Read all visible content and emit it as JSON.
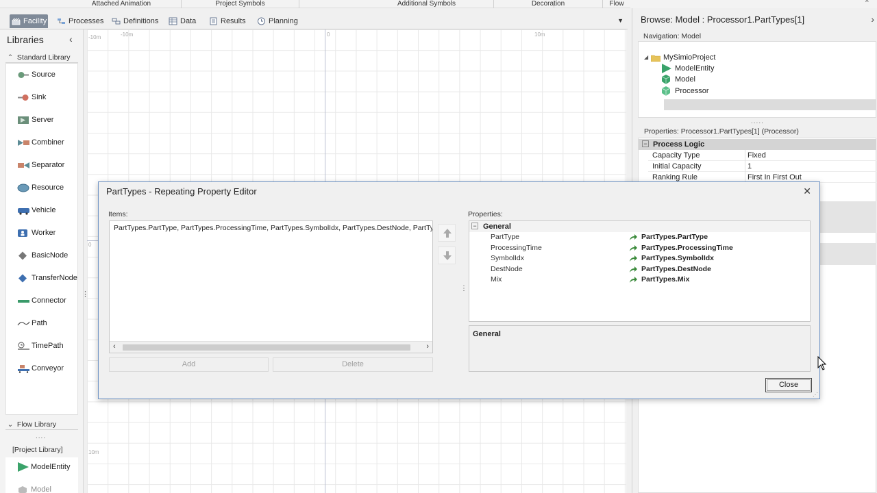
{
  "ribbon_groups": [
    "Attached Animation",
    "Project Symbols",
    "Additional Symbols",
    "Decoration",
    "Flow"
  ],
  "tabs": [
    {
      "label": "Facility",
      "icon": "facility-icon",
      "active": true
    },
    {
      "label": "Processes",
      "icon": "processes-icon"
    },
    {
      "label": "Definitions",
      "icon": "definitions-icon"
    },
    {
      "label": "Data",
      "icon": "data-icon"
    },
    {
      "label": "Results",
      "icon": "results-icon"
    },
    {
      "label": "Planning",
      "icon": "planning-icon"
    }
  ],
  "libraries": {
    "title": "Libraries",
    "standard_section": "Standard Library",
    "standard_items": [
      "Source",
      "Sink",
      "Server",
      "Combiner",
      "Separator",
      "Resource",
      "Vehicle",
      "Worker",
      "BasicNode",
      "TransferNode",
      "Connector",
      "Path",
      "TimePath",
      "Conveyor"
    ],
    "flow_section": "Flow Library",
    "project_section": "[Project Library]",
    "project_items": [
      "ModelEntity",
      "Model"
    ]
  },
  "canvas": {
    "ticks": [
      "-10m",
      "-10m",
      "0",
      "10m",
      "0",
      "10m"
    ]
  },
  "browse": {
    "title": "Browse: Model : Processor1.PartTypes[1]",
    "navigation_label": "Navigation: Model",
    "tree": [
      {
        "label": "MySimioProject",
        "icon": "folder-icon"
      },
      {
        "label": "ModelEntity",
        "icon": "entity-icon"
      },
      {
        "label": "Model",
        "icon": "model-icon",
        "selected": true
      },
      {
        "label": "Processor",
        "icon": "model-icon"
      }
    ],
    "properties_label": "Properties: Processor1.PartTypes[1] (Processor)",
    "category": "Process Logic",
    "rows": [
      {
        "name": "Capacity Type",
        "value": "Fixed"
      },
      {
        "name": "Initial Capacity",
        "value": "1"
      },
      {
        "name": "Ranking Rule",
        "value": "First In First Out"
      }
    ]
  },
  "dialog": {
    "title": "PartTypes - Repeating Property Editor",
    "items_label": "Items:",
    "items_text": "PartTypes.PartType, PartTypes.ProcessingTime, PartTypes.SymbolIdx, PartTypes.DestNode, PartTypes.",
    "add_label": "Add",
    "delete_label": "Delete",
    "properties_label": "Properties:",
    "group": "General",
    "properties": [
      {
        "name": "PartType",
        "value": "PartTypes.PartType"
      },
      {
        "name": "ProcessingTime",
        "value": "PartTypes.ProcessingTime"
      },
      {
        "name": "SymbolIdx",
        "value": "PartTypes.SymbolIdx"
      },
      {
        "name": "DestNode",
        "value": "PartTypes.DestNode"
      },
      {
        "name": "Mix",
        "value": "PartTypes.Mix"
      }
    ],
    "description_title": "General",
    "close_label": "Close"
  }
}
